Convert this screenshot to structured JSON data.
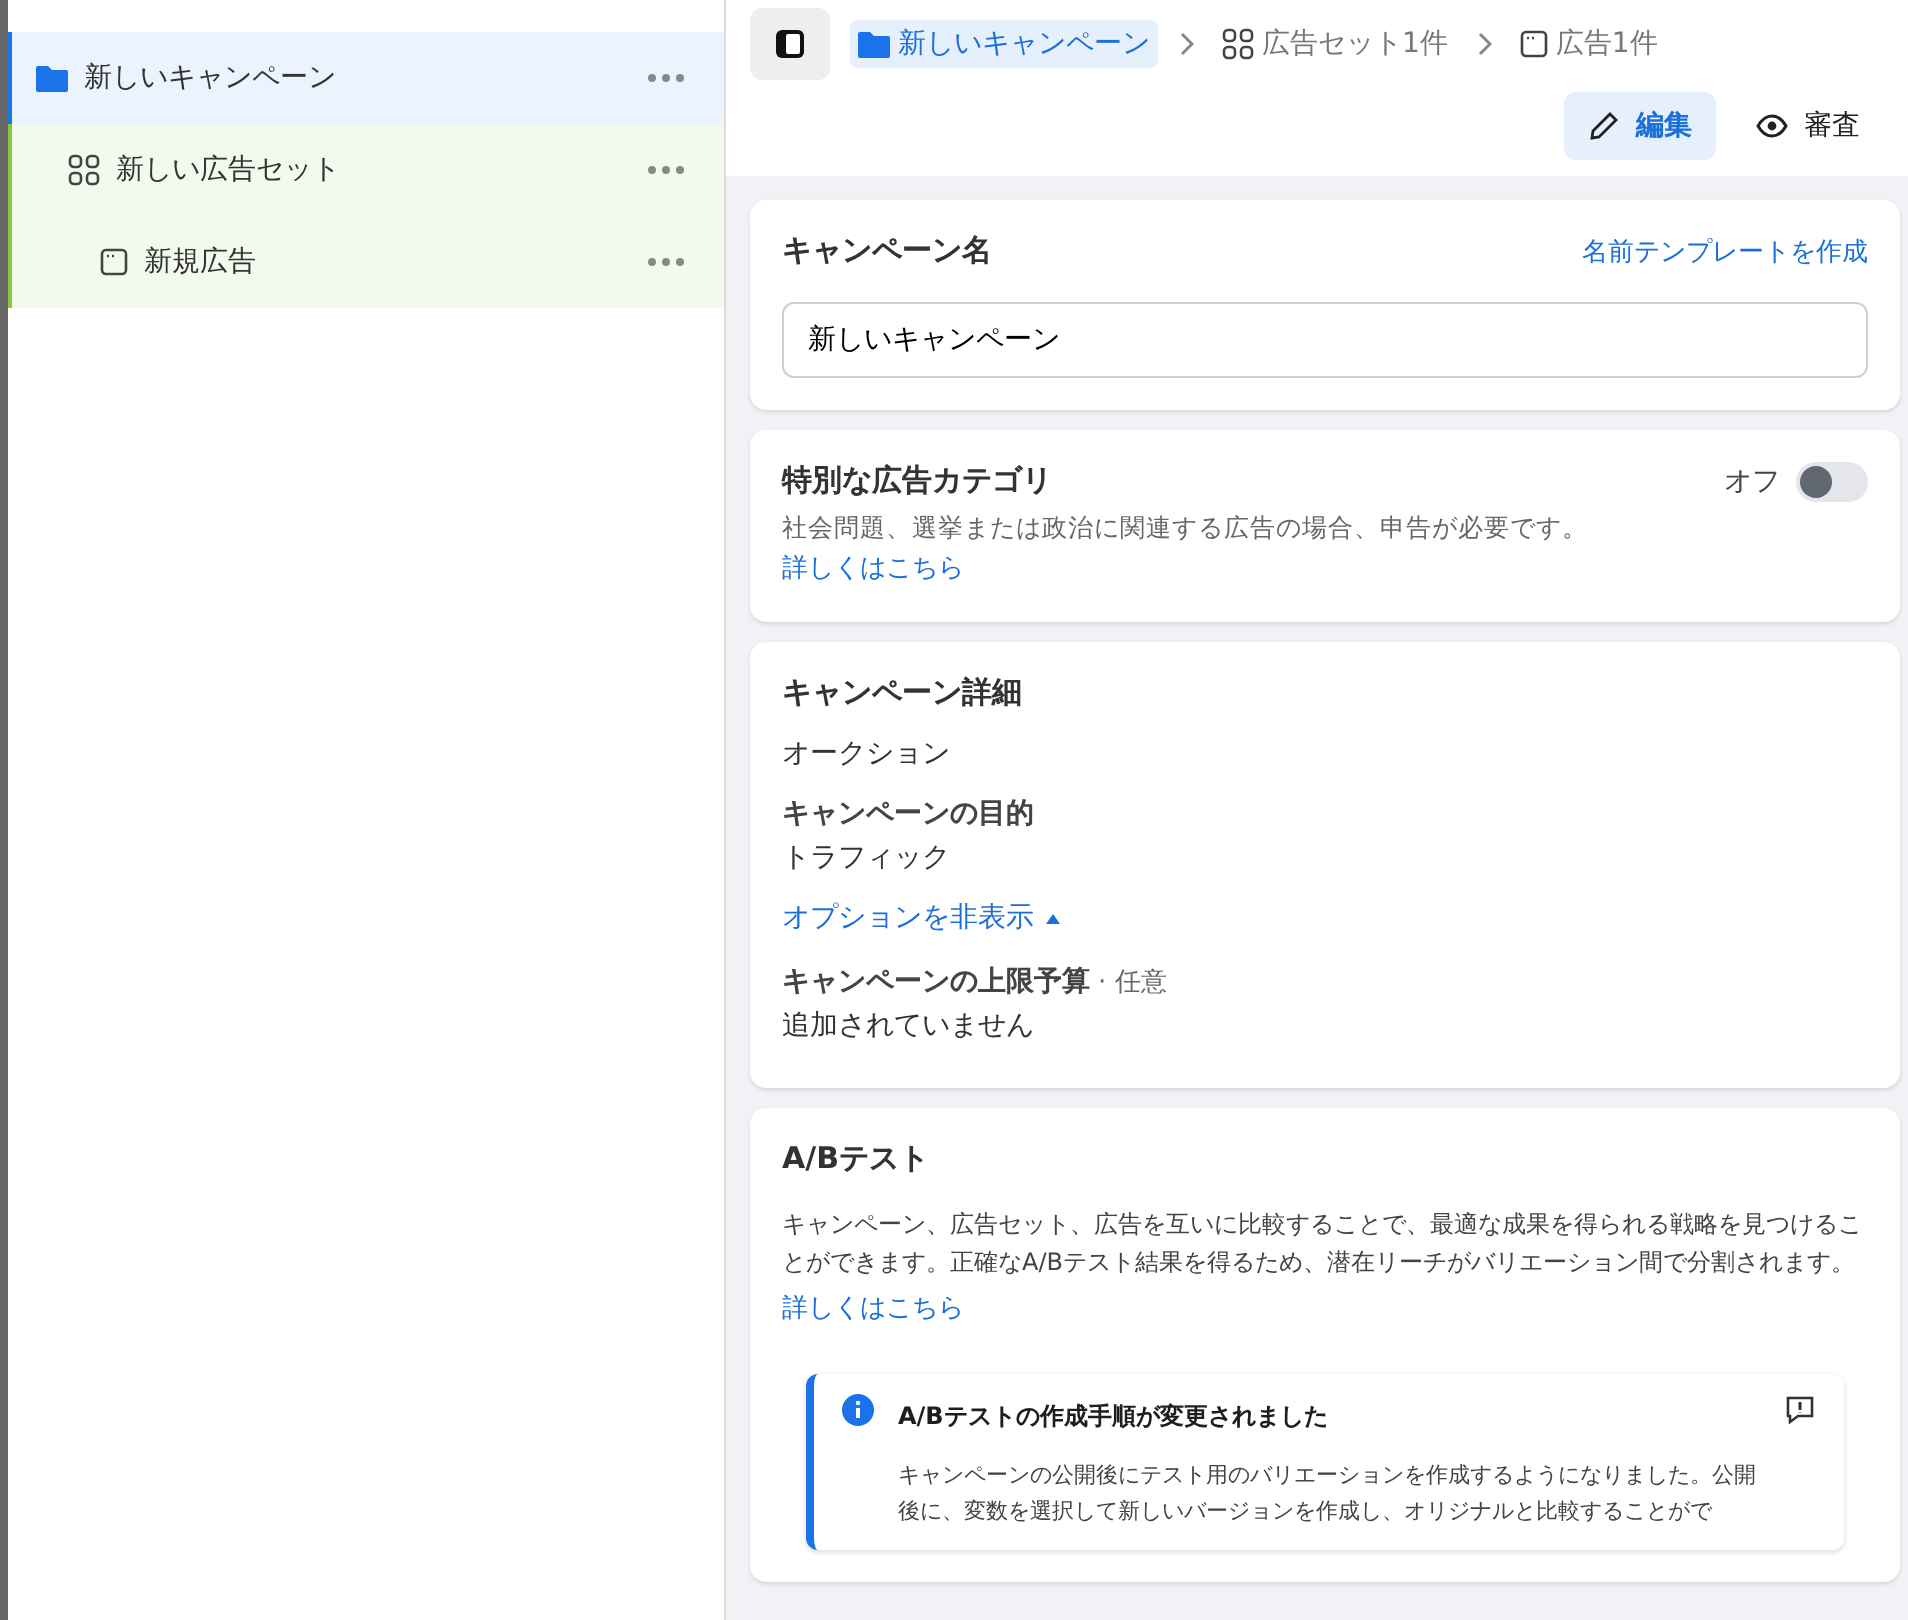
{
  "tree": [
    {
      "kind": "campaign",
      "label": "新しいキャンペーン",
      "selected": true,
      "children": [
        {
          "kind": "adset",
          "label": "新しい広告セット",
          "selected": false,
          "children": [
            {
              "kind": "ad",
              "label": "新規広告",
              "selected": false
            }
          ]
        }
      ]
    }
  ],
  "breadcrumbs": [
    {
      "kind": "campaign",
      "label": "新しいキャンペーン",
      "selected": true
    },
    {
      "kind": "adset",
      "label": "広告セット1件",
      "selected": false
    },
    {
      "kind": "ad",
      "label": "広告1件",
      "selected": false
    }
  ],
  "modes": [
    {
      "kind": "edit",
      "label": "編集",
      "selected": true
    },
    {
      "kind": "review",
      "label": "審査",
      "selected": false
    }
  ],
  "campaign_name": {
    "title": "キャンペーン名",
    "link": "名前テンプレートを作成",
    "value": "新しいキャンペーン"
  },
  "special_category": {
    "title": "特別な広告カテゴリ",
    "description": "社会問題、選挙または政治に関連する広告の場合、申告が必要です。",
    "link": "詳しくはこちら",
    "toggle_label": "オフ",
    "on": false
  },
  "details": {
    "title": "キャンペーン詳細",
    "buying_type": "オークション",
    "objective_label": "キャンペーンの目的",
    "objective": "トラフィック",
    "options_link": "オプションを非表示",
    "budget_label": "キャンペーンの上限予算",
    "budget_hint": "· 任意",
    "budget_value": "追加されていません"
  },
  "ab_test": {
    "title": "A/Bテスト",
    "description": "キャンペーン、広告セット、広告を互いに比較することで、最適な成果を得られる戦略を見つけることができます。正確なA/Bテスト結果を得るため、潜在リーチがバリエーション間で分割されます。",
    "link": "詳しくはこちら",
    "notice_title": "A/Bテストの作成手順が変更されました",
    "notice_body": "キャンペーンの公開後にテスト用のバリエーションを作成するようになりました。公開後に、変数を選択して新しいバージョンを作成し、オリジナルと比較することがで"
  }
}
